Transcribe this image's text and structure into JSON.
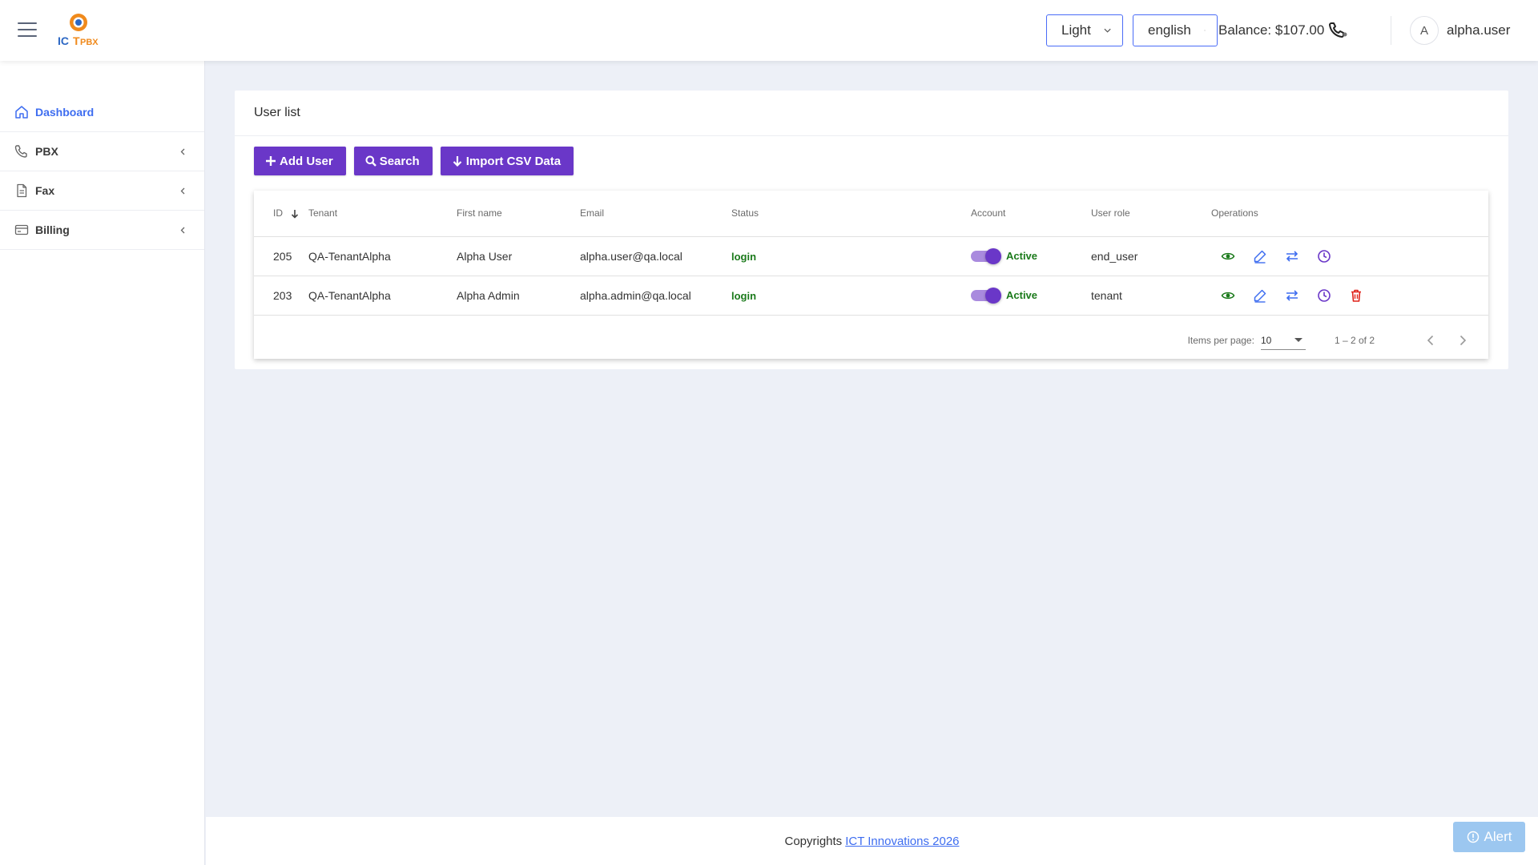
{
  "header": {
    "logo_text": "ICTPBX",
    "theme": "Light",
    "language": "english",
    "balance": "Balance: $107.00",
    "avatar_initial": "A",
    "username": "alpha.user"
  },
  "sidebar": {
    "items": [
      {
        "label": "Dashboard",
        "icon": "home-icon",
        "active": true
      },
      {
        "label": "PBX",
        "icon": "phone-icon"
      },
      {
        "label": "Fax",
        "icon": "document-icon"
      },
      {
        "label": "Billing",
        "icon": "credit-card-icon"
      }
    ]
  },
  "main": {
    "title": "User list",
    "buttons": {
      "add_user": "Add User",
      "search": "Search",
      "import_csv": "Import CSV Data"
    },
    "table": {
      "columns": [
        "ID",
        "Tenant",
        "First name",
        "Email",
        "Status",
        "Account",
        "User role",
        "Operations"
      ],
      "rows": [
        {
          "id": "205",
          "tenant": "QA-TenantAlpha",
          "first_name": "Alpha User",
          "email": "alpha.user@qa.local",
          "status": "login",
          "account": "Active",
          "role": "end_user",
          "can_delete": false
        },
        {
          "id": "203",
          "tenant": "QA-TenantAlpha",
          "first_name": "Alpha Admin",
          "email": "alpha.admin@qa.local",
          "status": "login",
          "account": "Active",
          "role": "tenant",
          "can_delete": true
        }
      ]
    },
    "paginator": {
      "items_per_page_label": "Items per page:",
      "page_size": "10",
      "range": "1 – 2 of 2"
    }
  },
  "footer": {
    "copyright_prefix": "Copyrights",
    "copyright_link": "ICT Innovations 2026",
    "alert_label": "Alert"
  },
  "colors": {
    "primary_purple": "#6a37c8",
    "link_blue": "#3e6df0",
    "success_green": "#1b7a1b",
    "danger_red": "#e0231b",
    "page_bg": "#edf0f7"
  }
}
